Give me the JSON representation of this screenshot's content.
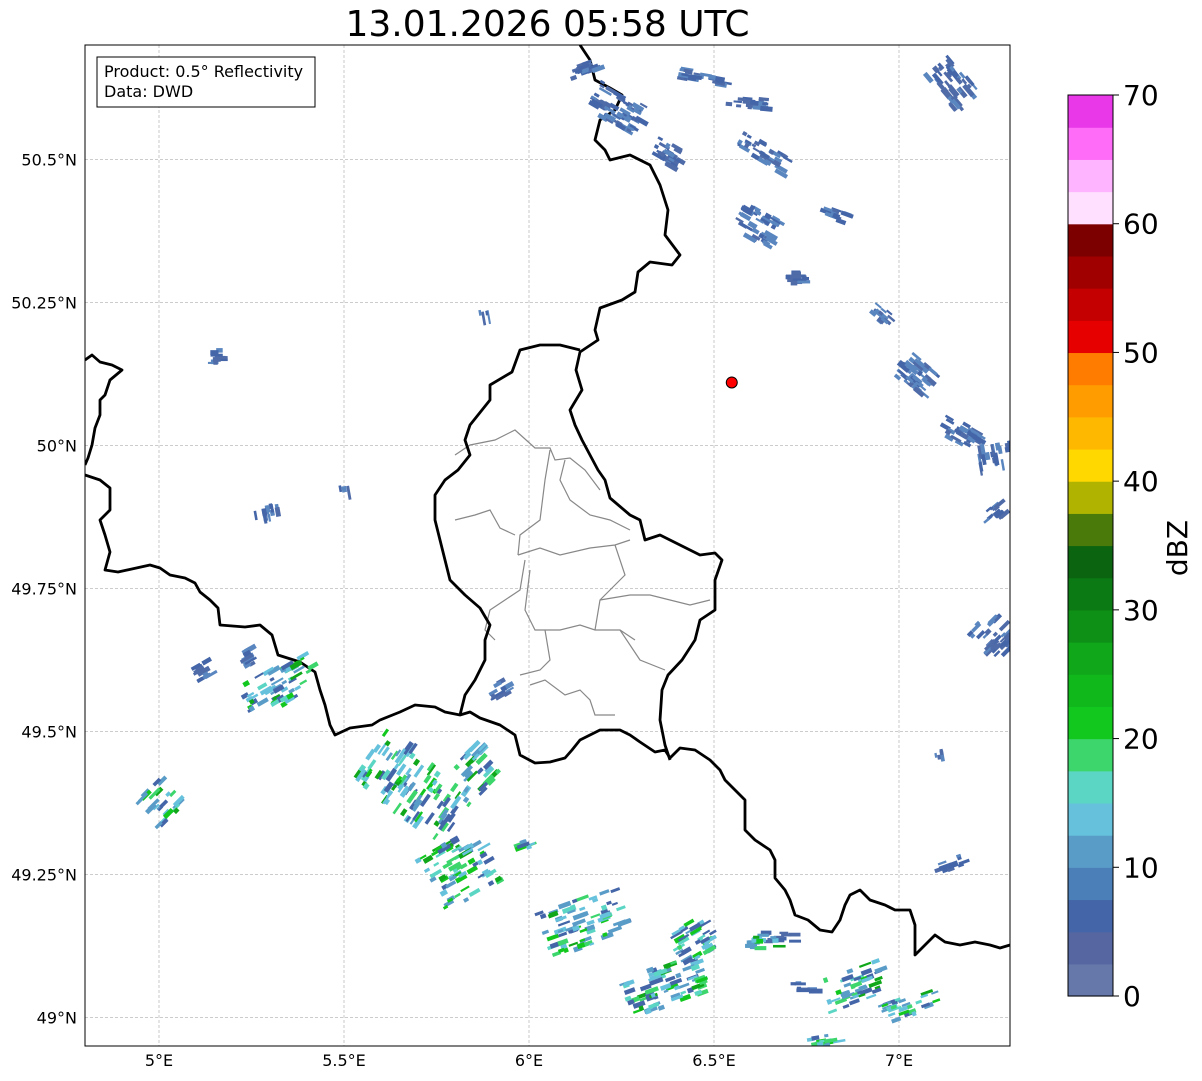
{
  "title": "13.01.2026 05:58 UTC",
  "info_box": {
    "line1": "Product: 0.5° Reflectivity",
    "line2": "Data: DWD"
  },
  "map": {
    "lon_range": [
      4.8,
      7.3
    ],
    "lat_range": [
      48.95,
      50.7
    ],
    "lon_ticks": [
      {
        "value": 5.0,
        "label": "5°E"
      },
      {
        "value": 5.5,
        "label": "5.5°E"
      },
      {
        "value": 6.0,
        "label": "6°E"
      },
      {
        "value": 6.5,
        "label": "6.5°E"
      },
      {
        "value": 7.0,
        "label": "7°E"
      }
    ],
    "lat_ticks": [
      {
        "value": 49.0,
        "label": "49°N"
      },
      {
        "value": 49.25,
        "label": "49.25°N"
      },
      {
        "value": 49.5,
        "label": "49.5°N"
      },
      {
        "value": 49.75,
        "label": "49.75°N"
      },
      {
        "value": 50.0,
        "label": "50°N"
      },
      {
        "value": 50.25,
        "label": "50.25°N"
      },
      {
        "value": 50.5,
        "label": "50.5°N"
      }
    ],
    "radar_site": {
      "lon": 6.548,
      "lat": 50.11,
      "color": "#ff0000"
    }
  },
  "colorbar": {
    "label": "dBZ",
    "min": 0,
    "max": 70,
    "tick_values": [
      0,
      10,
      20,
      30,
      40,
      50,
      60,
      70
    ],
    "tick_labels": [
      "0",
      "10",
      "20",
      "30",
      "40",
      "50",
      "60",
      "70"
    ],
    "colors": [
      "#6677aa",
      "#5566a0",
      "#4466a8",
      "#4a7fb8",
      "#5a9cc8",
      "#66c2dc",
      "#5cd6c4",
      "#3cd66c",
      "#12c81e",
      "#10b81c",
      "#10a81a",
      "#0e9016",
      "#0c7a14",
      "#0a6410",
      "#4a7a0a",
      "#b0b400",
      "#ffd800",
      "#ffb800",
      "#ff9c00",
      "#ff7c00",
      "#e60000",
      "#c40000",
      "#a00000",
      "#7c0000",
      "#ffe0ff",
      "#ffb4ff",
      "#ff6cf8",
      "#e838e8"
    ]
  }
}
